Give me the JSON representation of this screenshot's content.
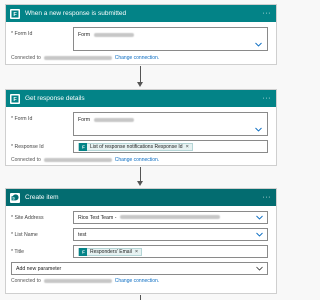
{
  "trigger": {
    "title": "When a new response is submitted",
    "more_label": "···",
    "form_id_label": "Form Id",
    "form_id_value": "Form",
    "connected_label": "Connected to",
    "change_connection": "Change connection."
  },
  "get_details": {
    "title": "Get response details",
    "more_label": "···",
    "form_id_label": "Form Id",
    "form_id_value": "Form",
    "response_id_label": "Response Id",
    "response_id_token": "List of response notifications Response Id",
    "connected_label": "Connected to",
    "change_connection": "Change connection."
  },
  "create_item": {
    "title": "Create item",
    "more_label": "···",
    "site_address_label": "Site Address",
    "site_address_value": "Rios Test Team -",
    "list_name_label": "List Name",
    "list_name_value": "test",
    "title_label": "Title",
    "title_token": "Responders' Email",
    "add_parameter_placeholder": "Add new parameter",
    "connected_label": "Connected to",
    "change_connection": "Change connection."
  },
  "colors": {
    "forms_header": "#038387",
    "sharepoint_header": "#036c70",
    "link": "#0a6cc2"
  },
  "icons": {
    "forms": "forms-icon",
    "sharepoint": "sharepoint-icon",
    "chevron": "chevron-down-icon",
    "remove": "close-icon"
  }
}
